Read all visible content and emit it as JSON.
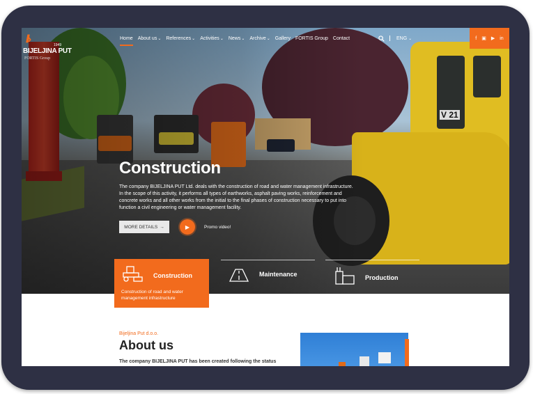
{
  "brand": {
    "logo_year": "1949",
    "logo_name": "BIJELJINA PUT",
    "logo_group": "FORTIS Group",
    "accent_color": "#f26b1d"
  },
  "nav": {
    "items": [
      {
        "label": "Home",
        "has_dropdown": false,
        "active": true
      },
      {
        "label": "About us",
        "has_dropdown": true
      },
      {
        "label": "References",
        "has_dropdown": true
      },
      {
        "label": "Activities",
        "has_dropdown": true
      },
      {
        "label": "News",
        "has_dropdown": true
      },
      {
        "label": "Archive",
        "has_dropdown": true
      },
      {
        "label": "Gallery",
        "has_dropdown": false
      },
      {
        "label": "FORTIS Group",
        "has_dropdown": false
      },
      {
        "label": "Contact",
        "has_dropdown": false
      }
    ],
    "search_icon": "search-icon",
    "lang": "ENG"
  },
  "social": [
    "f",
    "ig",
    "yt",
    "in"
  ],
  "hero": {
    "title": "Construction",
    "description": "The company BIJELJINA PUT Ltd. deals with the construction of road and water management infrastructure. In the scope of this activity, it performs all types of earthworks, asphalt paving works, reinforcement and concrete works and all other works from the initial to the final phases of construction necessary to put into function a civil engineering or water management facility.",
    "more_details": "MORE DETAILS",
    "promo_label": "Promo video!"
  },
  "cards": [
    {
      "title": "Construction",
      "desc": "Construction of road and water management infrastructure",
      "icon": "roller-icon",
      "active": true
    },
    {
      "title": "Maintenance",
      "icon": "road-icon",
      "active": false
    },
    {
      "title": "Production",
      "icon": "factory-icon",
      "active": false
    }
  ],
  "about": {
    "kicker": "Bijeljina Put d.o.o.",
    "title": "About us",
    "text": "The company BIJELJINA PUT has been created following the status"
  }
}
